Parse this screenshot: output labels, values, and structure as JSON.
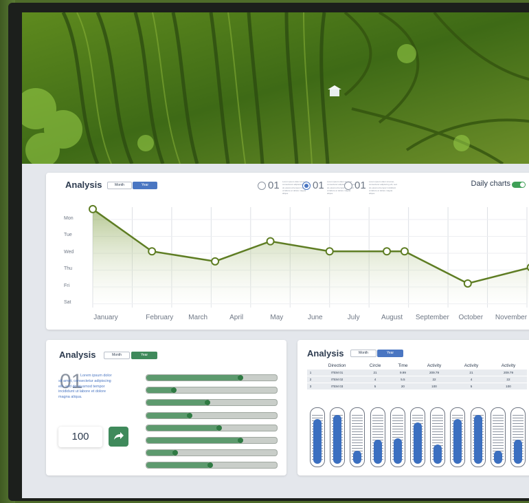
{
  "colors": {
    "accent_blue": "#4a76c2",
    "accent_green": "#3f8a5b",
    "line_green": "#5e7d23",
    "bar_blue": "#3b6fc0"
  },
  "top_card": {
    "title": "Analysis",
    "tab_month": "Month",
    "tab_year": "Year",
    "options": [
      {
        "num": "01",
        "text": "Lorem ipsum dolor sit amet, consectetur adipiscing elit, sed do eiusmod tempor incididunt ut labore et dolore magna aliqua."
      },
      {
        "num": "01",
        "text": "Lorem ipsum dolor sit amet, consectetur adipiscing elit, sed do eiusmod tempor incididunt ut labore et dolore magna aliqua."
      },
      {
        "num": "01",
        "text": "Lorem ipsum dolor sit amet, consectetur adipiscing elit, sed do eiusmod tempor incididunt ut labore et dolore magna aliqua."
      }
    ],
    "selected_option": 1,
    "daily_charts_label": "Daily charts",
    "daily_charts_on": true
  },
  "chart_data": {
    "type": "area",
    "categories": [
      "January",
      "February",
      "March",
      "April",
      "May",
      "June",
      "July",
      "August",
      "",
      "September",
      "October",
      "November"
    ],
    "y_labels": [
      "Mon",
      "Tue",
      "Wed",
      "Thu",
      "Fri",
      "Sat"
    ],
    "values": [
      0.1,
      2.2,
      2.7,
      1.7,
      2.2,
      2.2,
      2.2,
      3.8,
      3.0
    ],
    "points": [
      {
        "x": 0,
        "y": 0.1
      },
      {
        "x": 1.5,
        "y": 2.2
      },
      {
        "x": 3.1,
        "y": 2.7
      },
      {
        "x": 4.5,
        "y": 1.7
      },
      {
        "x": 6.0,
        "y": 2.2
      },
      {
        "x": 7.45,
        "y": 2.2
      },
      {
        "x": 7.9,
        "y": 2.2
      },
      {
        "x": 9.5,
        "y": 3.8
      },
      {
        "x": 11.1,
        "y": 3.0
      }
    ],
    "ylim": [
      0,
      5
    ],
    "grid": true
  },
  "left_card": {
    "title": "Analysis",
    "tab_month": "Month",
    "tab_year": "Year",
    "big_number": "01",
    "paragraph": "Lorem ipsum dolor sit amet, consectetur adipiscing elit, sed do eiusmod tempor incididunt ut labore et dolore magna aliqua.",
    "input_value": "100",
    "share_icon": "share-arrow-icon",
    "sliders": [
      0.72,
      0.21,
      0.47,
      0.33,
      0.56,
      0.72,
      0.22,
      0.49
    ]
  },
  "right_card": {
    "title": "Analysis",
    "tab_month": "Month",
    "tab_year": "Year",
    "table": {
      "headers": [
        "",
        "Direction",
        "Circle",
        "Time",
        "Activity",
        "Activity",
        "Activity"
      ],
      "rows": [
        [
          "1",
          "ITEM 01",
          "21",
          "9.99",
          "209.79",
          "21",
          "209.79"
        ],
        [
          "2",
          "ITEM 02",
          "4",
          "5.5",
          "22",
          "4",
          "22"
        ],
        [
          "3",
          "ITEM 03",
          "5",
          "20",
          "100",
          "5",
          "100"
        ]
      ]
    },
    "gauges": [
      0.85,
      0.92,
      0.25,
      0.45,
      0.48,
      0.78,
      0.36,
      0.85,
      0.92,
      0.25,
      0.45
    ]
  }
}
